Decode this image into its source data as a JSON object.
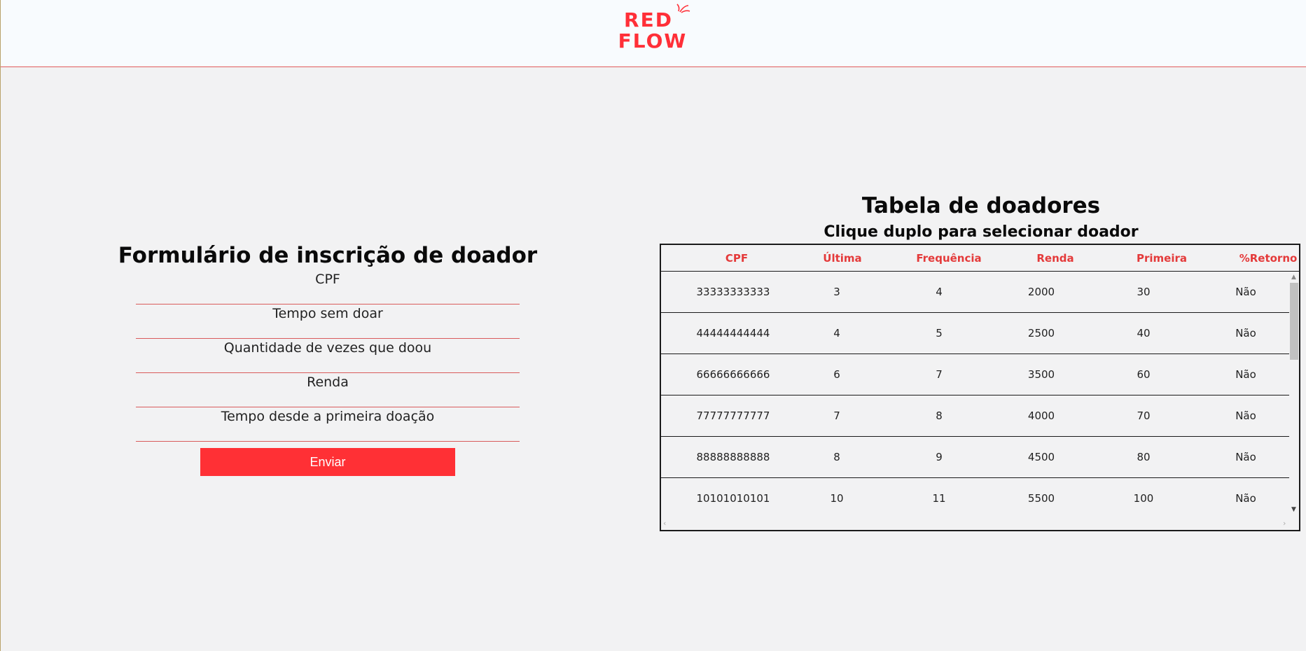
{
  "brand": {
    "line1": "RED",
    "line2": "FLOW",
    "accent": "#ff2f38"
  },
  "form": {
    "title": "Formulário de inscrição de doador",
    "fields": [
      {
        "placeholder": "CPF"
      },
      {
        "placeholder": "Tempo sem doar"
      },
      {
        "placeholder": "Quantidade de vezes que doou"
      },
      {
        "placeholder": "Renda"
      },
      {
        "placeholder": "Tempo desde a primeira doação"
      }
    ],
    "submit_label": "Enviar"
  },
  "table": {
    "title": "Tabela de doadores",
    "subtitle": "Clique duplo para selecionar doador",
    "columns": [
      "CPF",
      "Última",
      "Frequência",
      "Renda",
      "Primeira",
      "%Retorno"
    ],
    "rows": [
      [
        "33333333333",
        "3",
        "4",
        "2000",
        "30",
        "Não"
      ],
      [
        "44444444444",
        "4",
        "5",
        "2500",
        "40",
        "Não"
      ],
      [
        "66666666666",
        "6",
        "7",
        "3500",
        "60",
        "Não"
      ],
      [
        "77777777777",
        "7",
        "8",
        "4000",
        "70",
        "Não"
      ],
      [
        "88888888888",
        "8",
        "9",
        "4500",
        "80",
        "Não"
      ],
      [
        "10101010101",
        "10",
        "11",
        "5500",
        "100",
        "Não"
      ]
    ]
  }
}
